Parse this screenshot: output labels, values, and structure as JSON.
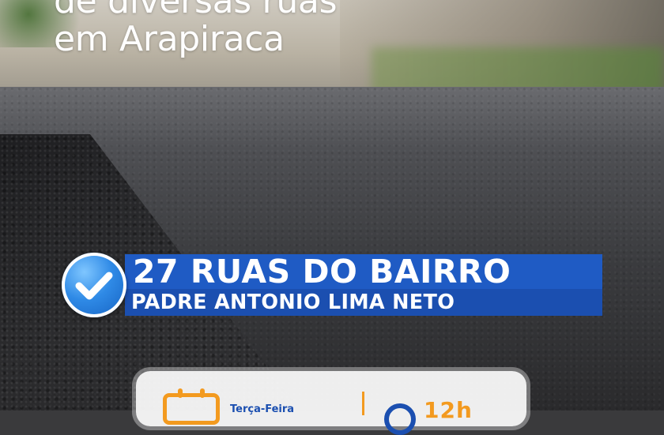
{
  "headline": {
    "line1": "de diversas ruas",
    "line2": "em Arapiraca"
  },
  "banner": {
    "line1": "27 RUAS DO BAIRRO",
    "line2": "PADRE ANTONIO LIMA NETO",
    "check_icon": "check-circle-icon",
    "color": "#1f5bc4"
  },
  "info_card": {
    "date_label": "Terça-Feira",
    "calendar_icon": "calendar-icon",
    "clock_icon": "clock-icon",
    "time_partial": "12h",
    "accent_orange": "#f39a1f",
    "accent_blue": "#1b4fb0"
  }
}
